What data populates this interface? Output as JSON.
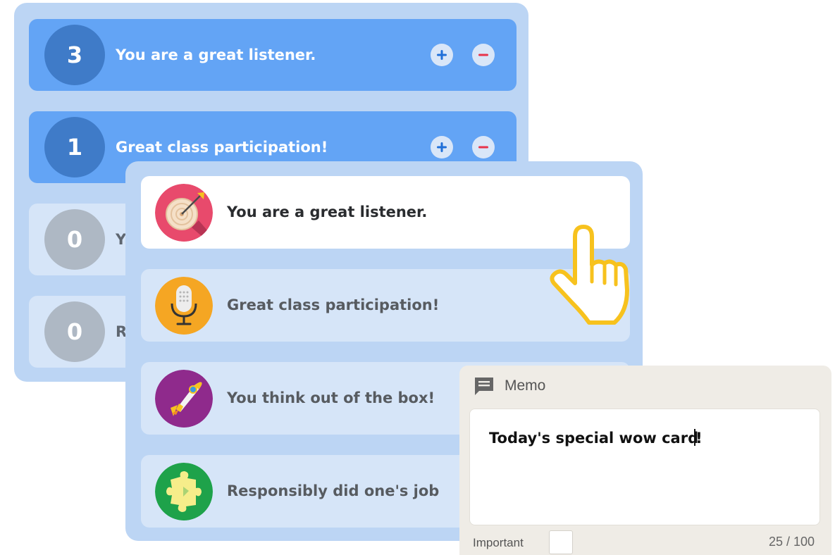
{
  "score_list": {
    "rows": [
      {
        "count": "3",
        "label": "You are a great listener.",
        "state": "active"
      },
      {
        "count": "1",
        "label": "Great class participation!",
        "state": "active"
      },
      {
        "count": "0",
        "label": "Y",
        "state": "inactive"
      },
      {
        "count": "0",
        "label": "R",
        "state": "inactive"
      }
    ],
    "plus_icon": "plus-icon",
    "minus_icon": "minus-icon",
    "plus_color": "#1f6fd8",
    "minus_color": "#e8334a"
  },
  "card_picker": {
    "cards": [
      {
        "label": "You are a great listener.",
        "icon": "target-icon",
        "icon_bg": "#e84a6c",
        "selected": true
      },
      {
        "label": "Great class participation!",
        "icon": "microphone-icon",
        "icon_bg": "#f5a623",
        "selected": false
      },
      {
        "label": "You think out of the box!",
        "icon": "rocket-icon",
        "icon_bg": "#8f2a8c",
        "selected": false
      },
      {
        "label": "Responsibly did one's job",
        "icon": "puzzle-icon",
        "icon_bg": "#1ea24a",
        "selected": false
      }
    ]
  },
  "cursor": {
    "icon": "hand-pointer-icon",
    "color": "#f7c21e"
  },
  "memo": {
    "title": "Memo",
    "icon": "memo-icon",
    "text": "Today's special wow card",
    "text_tail": "!",
    "important_label": "Important",
    "char_count": "25 / 100"
  }
}
